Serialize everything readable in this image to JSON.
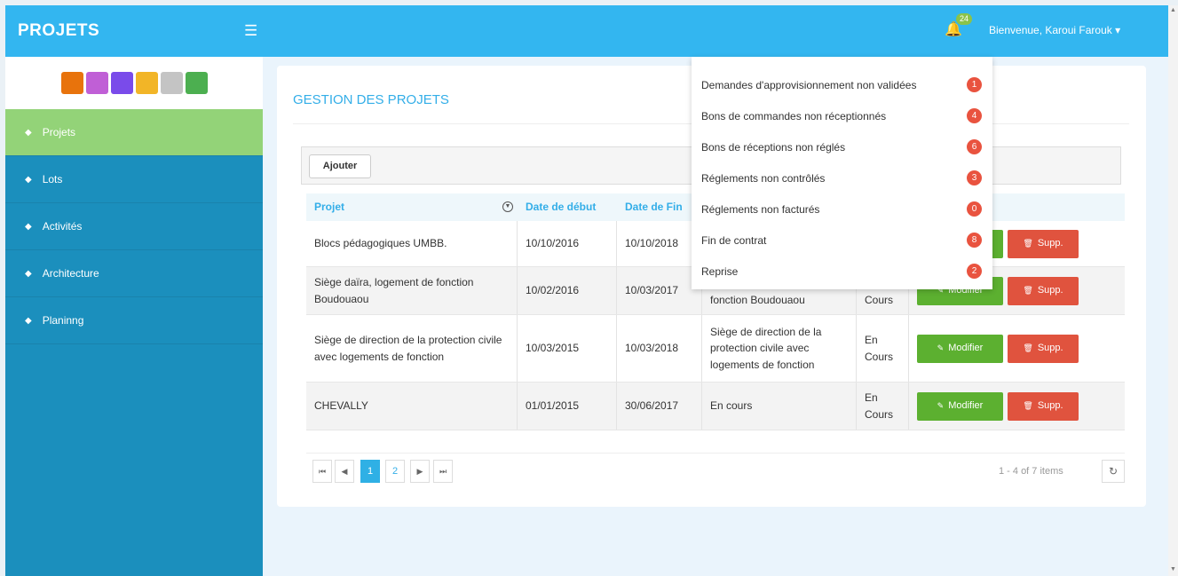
{
  "header": {
    "brand": "PROJETS",
    "menu_icon": "hamburger-icon",
    "notification_count": "24",
    "welcome": "Bienvenue, Karoui Farouk"
  },
  "colors": {
    "topbar": "#33b6f0",
    "sidebar": "#1b8fbd",
    "sidebar_active": "#93d378",
    "accent": "#33aee8",
    "btn_modify": "#5cb030",
    "btn_delete": "#e0533e",
    "swatches": [
      "#e8730c",
      "#c05fd6",
      "#7a4bea",
      "#f2b527",
      "#c4c4c4",
      "#4caf50"
    ]
  },
  "sidebar": {
    "items": [
      {
        "label": "Projets",
        "active": true
      },
      {
        "label": "Lots",
        "active": false
      },
      {
        "label": "Activités",
        "active": false
      },
      {
        "label": "Architecture",
        "active": false
      },
      {
        "label": "Planinng",
        "active": false
      }
    ]
  },
  "main": {
    "title": "GESTION DES PROJETS",
    "add_button": "Ajouter",
    "columns": [
      "Projet",
      "Date de début",
      "Date de Fin"
    ],
    "rows": [
      {
        "project": "Blocs pédagogiques UMBB.",
        "start": "10/10/2016",
        "end": "10/10/2018",
        "desc": "",
        "status": ""
      },
      {
        "project": "Siège daïra, logement de fonction Boudouaou",
        "start": "10/02/2016",
        "end": "10/03/2017",
        "desc": "fonction Boudouaou",
        "status": "Cours"
      },
      {
        "project": "Siège de direction de la protection civile avec logements de fonction",
        "start": "10/03/2015",
        "end": "10/03/2018",
        "desc": "Siège de direction de la protection civile avec logements de fonction",
        "status": "En Cours"
      },
      {
        "project": "CHEVALLY",
        "start": "01/01/2015",
        "end": "30/06/2017",
        "desc": "En cours",
        "status": "En Cours"
      }
    ],
    "modify_label": "Modifier",
    "delete_label": "Supp."
  },
  "pager": {
    "pages": [
      "1",
      "2"
    ],
    "current": "1",
    "info": "1 - 4 of 7 items"
  },
  "notifications": [
    {
      "label": "Demandes d'approvisionnement non validées",
      "count": "1"
    },
    {
      "label": "Bons de commandes non réceptionnés",
      "count": "4"
    },
    {
      "label": "Bons de réceptions non réglés",
      "count": "6"
    },
    {
      "label": "Réglements non contrôlés",
      "count": "3"
    },
    {
      "label": "Réglements non facturés",
      "count": "0"
    },
    {
      "label": "Fin de contrat",
      "count": "8"
    },
    {
      "label": "Reprise",
      "count": "2"
    }
  ]
}
